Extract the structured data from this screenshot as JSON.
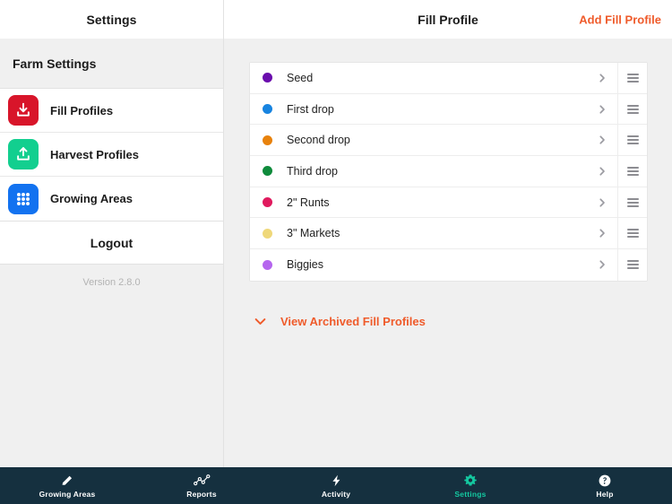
{
  "sidebar": {
    "header_title": "Settings",
    "section_label": "Farm Settings",
    "items": [
      {
        "label": "Fill Profiles",
        "icon": "download-icon",
        "icon_bg": "#d8152a"
      },
      {
        "label": "Harvest Profiles",
        "icon": "upload-icon",
        "icon_bg": "#12cf8f"
      },
      {
        "label": "Growing Areas",
        "icon": "grid-icon",
        "icon_bg": "#1272f0"
      }
    ],
    "logout_label": "Logout",
    "version_text": "Version 2.8.0"
  },
  "main": {
    "header_title": "Fill Profile",
    "add_label": "Add Fill Profile",
    "accent_color": "#ef5b2b",
    "rows": [
      {
        "label": "Seed",
        "color": "#6a0dad"
      },
      {
        "label": "First drop",
        "color": "#1884e0"
      },
      {
        "label": "Second drop",
        "color": "#e8820c"
      },
      {
        "label": "Third drop",
        "color": "#0f8b3c"
      },
      {
        "label": "2\" Runts",
        "color": "#e01a5e"
      },
      {
        "label": "3\" Markets",
        "color": "#efd87a"
      },
      {
        "label": "Biggies",
        "color": "#b566ee"
      }
    ],
    "chevron_icon": "chevron-right-icon",
    "handle_icon": "drag-handle-icon",
    "archived_caret_icon": "chevron-down-icon",
    "archived_label": "View Archived Fill Profiles"
  },
  "bottom_nav": {
    "active_color": "#14c8a0",
    "background": "#15303f",
    "items": [
      {
        "label": "Growing Areas",
        "icon": "pencil-icon",
        "active": false
      },
      {
        "label": "Reports",
        "icon": "chart-icon",
        "active": false
      },
      {
        "label": "Activity",
        "icon": "bolt-icon",
        "active": false
      },
      {
        "label": "Settings",
        "icon": "gear-icon",
        "active": true
      },
      {
        "label": "Help",
        "icon": "question-icon",
        "active": false
      }
    ]
  }
}
